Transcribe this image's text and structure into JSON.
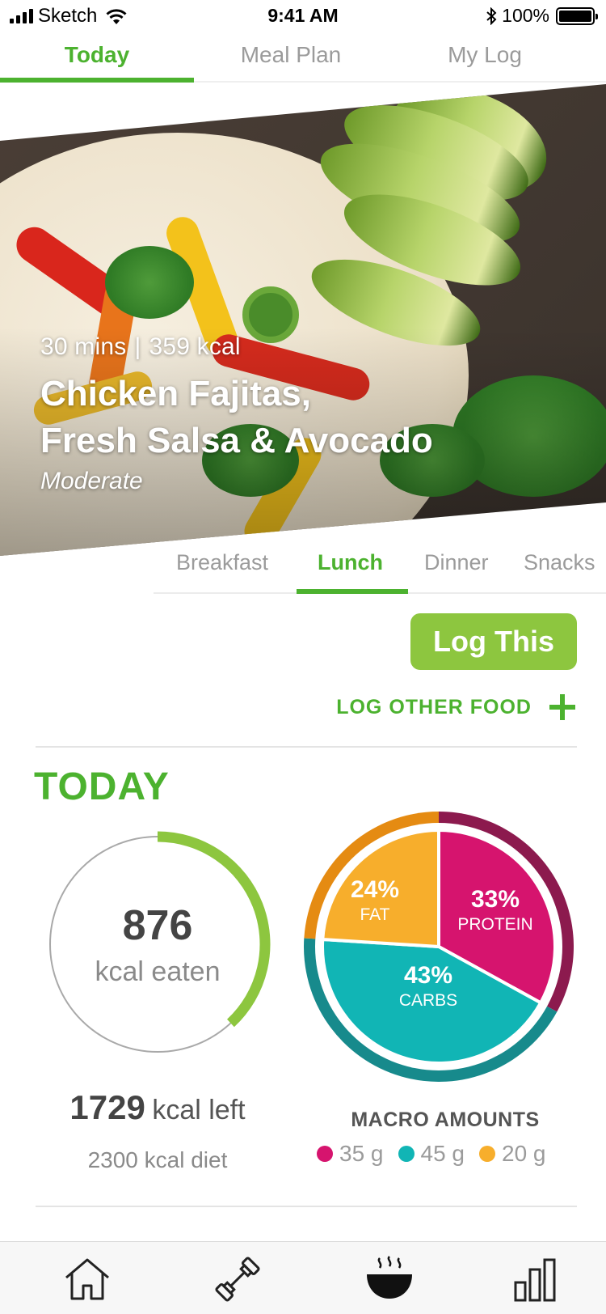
{
  "status_bar": {
    "carrier": "Sketch",
    "time": "9:41 AM",
    "battery": "100%"
  },
  "top_tabs": [
    {
      "label": "Today",
      "active": true
    },
    {
      "label": "Meal Plan",
      "active": false
    },
    {
      "label": "My Log",
      "active": false
    }
  ],
  "recipe": {
    "time": "30 mins",
    "separator": "|",
    "calories": "359 kcal",
    "title_line1": "Chicken Fajitas,",
    "title_line2": "Fresh Salsa & Avocado",
    "difficulty": "Moderate"
  },
  "meal_tabs": [
    {
      "label": "Breakfast",
      "active": false
    },
    {
      "label": "Lunch",
      "active": true
    },
    {
      "label": "Dinner",
      "active": false
    },
    {
      "label": "Snacks",
      "active": false
    }
  ],
  "actions": {
    "log_this": "Log This",
    "log_other_food": "LOG OTHER FOOD"
  },
  "today": {
    "title": "TODAY",
    "kcal_eaten": "876",
    "kcal_eaten_label": "kcal eaten",
    "kcal_left": "1729",
    "kcal_left_label": "kcal left",
    "kcal_diet": "2300 kcal diet",
    "progress_fraction": 0.381
  },
  "macros": {
    "title": "MACRO AMOUNTS",
    "slices": [
      {
        "name": "PROTEIN",
        "pct_label": "33%",
        "value": 33,
        "color": "#d6146e",
        "ring_color": "#8c1a4e"
      },
      {
        "name": "CARBS",
        "pct_label": "43%",
        "value": 43,
        "color": "#11b5b5",
        "ring_color": "#178a8c"
      },
      {
        "name": "FAT",
        "pct_label": "24%",
        "value": 24,
        "color": "#f7ae2c",
        "ring_color": "#e58b12"
      }
    ],
    "amounts": [
      {
        "label": "35 g",
        "color": "#d6146e"
      },
      {
        "label": "45 g",
        "color": "#11b5b5"
      },
      {
        "label": "20 g",
        "color": "#f7ae2c"
      }
    ]
  },
  "colors": {
    "accent": "#4cb22f",
    "button": "#8dc63f",
    "ring_progress": "#8dc63f"
  },
  "bottom_nav": [
    {
      "icon": "home-icon"
    },
    {
      "icon": "dumbbell-icon"
    },
    {
      "icon": "meal-bowl-icon"
    },
    {
      "icon": "bar-chart-icon"
    }
  ]
}
